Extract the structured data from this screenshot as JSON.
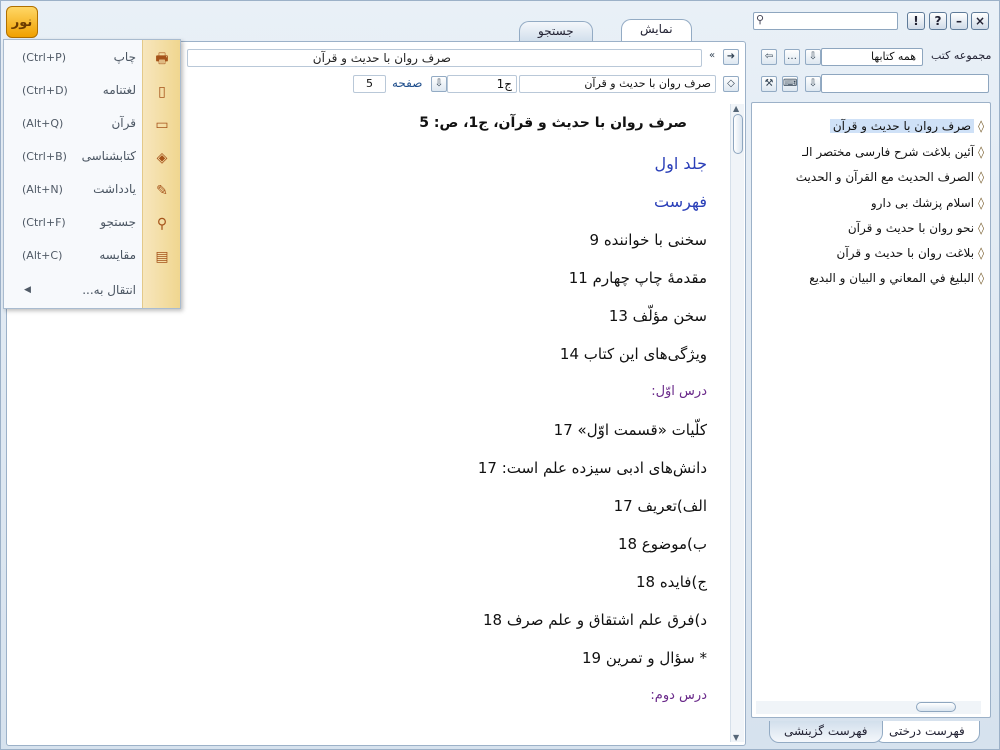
{
  "logo": {
    "text": "نور"
  },
  "tabs": [
    {
      "label": "نمایش",
      "active": true
    },
    {
      "label": "جستجو",
      "active": false
    }
  ],
  "window_buttons": {
    "help": "?",
    "info": "!",
    "minimize": "–",
    "close": "×"
  },
  "reader": {
    "path": "صرف روان با حديث و قرآن",
    "book_field": "صرف روان با حديث و قرآن",
    "volume_field": "ج1",
    "page_label": "صفحه",
    "page_value": "5",
    "heading": "صرف روان با حديث و قرآن، ج1، ص: 5",
    "lines": [
      {
        "text": "جلد اول",
        "style": "blue"
      },
      {
        "text": "فهرست",
        "style": "blue"
      },
      {
        "text": "سخنى با خواننده 9",
        "style": "normal"
      },
      {
        "text": "مقدمۀ چاپ چهارم 11",
        "style": "normal"
      },
      {
        "text": "سخن مؤلّف 13",
        "style": "normal"
      },
      {
        "text": "ويژگى‌هاى اين كتاب 14",
        "style": "normal"
      },
      {
        "text": "درس اوّل:",
        "style": "purple"
      },
      {
        "text": "كلّيات «قسمت اوّل» 17",
        "style": "normal"
      },
      {
        "text": "دانش‌هاى ادبى سيزده علم است: 17",
        "style": "normal"
      },
      {
        "text": "الف)تعريف 17",
        "style": "normal"
      },
      {
        "text": "ب)موضوع 18",
        "style": "normal"
      },
      {
        "text": "ج)فايده 18",
        "style": "normal"
      },
      {
        "text": "د)فرق علم اشتقاق و علم صرف 18",
        "style": "normal"
      },
      {
        "text": "* سؤال و تمرين 19",
        "style": "normal"
      },
      {
        "text": "درس دوم:",
        "style": "purple"
      }
    ]
  },
  "menu": {
    "items": [
      {
        "label": "چاپ",
        "shortcut": "(Ctrl+P)",
        "icon": "printer-icon",
        "glyph": "🖶"
      },
      {
        "label": "لغتنامه",
        "shortcut": "(Ctrl+D)",
        "icon": "dictionary-icon",
        "glyph": "▯"
      },
      {
        "label": "قرآن",
        "shortcut": "(Alt+Q)",
        "icon": "quran-icon",
        "glyph": "▭"
      },
      {
        "label": "كتابشناسی",
        "shortcut": "(Ctrl+B)",
        "icon": "bibliography-icon",
        "glyph": "◈"
      },
      {
        "label": "يادداشت",
        "shortcut": "(Alt+N)",
        "icon": "note-icon",
        "glyph": "✎"
      },
      {
        "label": "جستجو",
        "shortcut": "(Ctrl+F)",
        "icon": "search-icon",
        "glyph": "⚲"
      },
      {
        "label": "مقايسه",
        "shortcut": "(Alt+C)",
        "icon": "compare-icon",
        "glyph": "▤"
      }
    ],
    "transfer_label": "انتقال به..."
  },
  "right_panel": {
    "collection_label": "مجموعه كتب",
    "collection_value": "همه كتابها",
    "books": [
      {
        "title": "صرف روان با حديث و قرآن",
        "selected": true
      },
      {
        "title": "آئين بلاغت شرح فارسى مختصر الـ",
        "selected": false
      },
      {
        "title": "الصرف الحديث مع القرآن و الحديث",
        "selected": false
      },
      {
        "title": "اسلام پزشك بى دارو",
        "selected": false
      },
      {
        "title": "نحو روان با حديث و قرآن",
        "selected": false
      },
      {
        "title": "بلاغت روان با حديث و قرآن",
        "selected": false
      },
      {
        "title": "البليغ في المعاني و البيان و البديع",
        "selected": false
      }
    ],
    "bottom_tabs": [
      {
        "label": "فهرست درختی",
        "active": true
      },
      {
        "label": "فهرست گزينشی",
        "active": false
      }
    ]
  }
}
